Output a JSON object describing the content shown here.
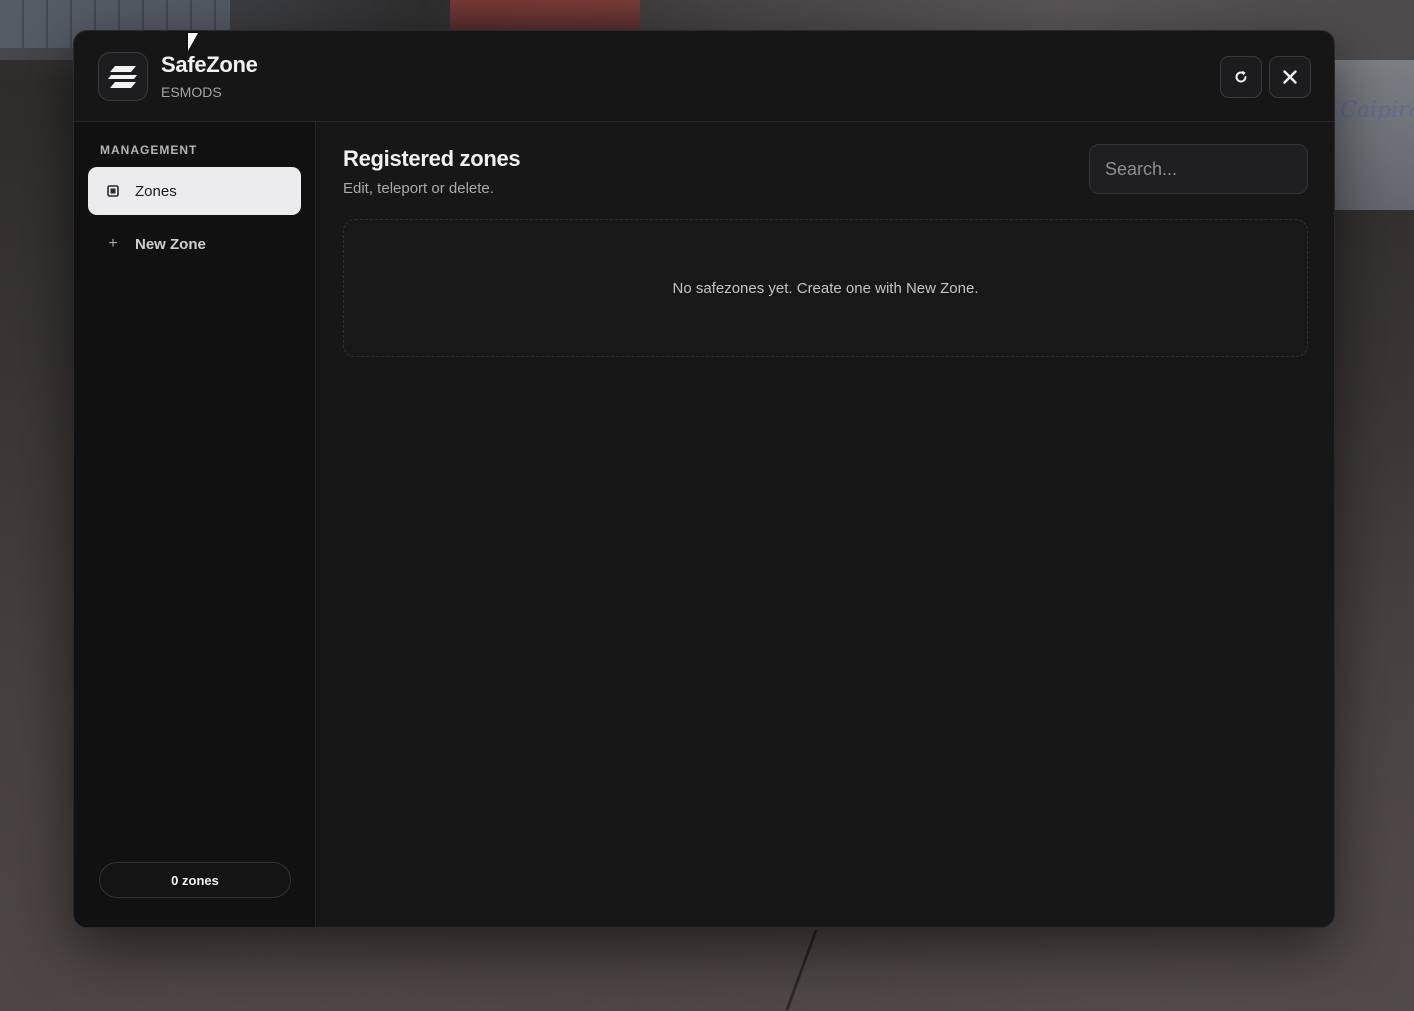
{
  "app": {
    "title": "SafeZone",
    "subtitle": "ESMODS",
    "logo_icon": "safezone-logo-icon"
  },
  "header_actions": {
    "refresh_icon": "refresh-icon",
    "close_icon": "close-icon"
  },
  "sidebar": {
    "section_label": "MANAGEMENT",
    "items": [
      {
        "label": "Zones",
        "icon": "list-square-icon",
        "active": true
      },
      {
        "label": "New Zone",
        "icon": "plus-icon",
        "active": false
      }
    ],
    "count_badge": "0 zones"
  },
  "main": {
    "title": "Registered zones",
    "subtitle": "Edit, teleport or delete.",
    "search": {
      "placeholder": "Search...",
      "value": ""
    },
    "empty_message": "No safezones yet. Create one with New Zone."
  },
  "background": {
    "sign_text": "Caipira"
  },
  "colors": {
    "panel_bg": "#161617",
    "sidebar_bg": "#111112",
    "active_item_bg": "#ececee",
    "text_primary": "#f2f2f2",
    "text_muted": "#a9a9ac"
  }
}
